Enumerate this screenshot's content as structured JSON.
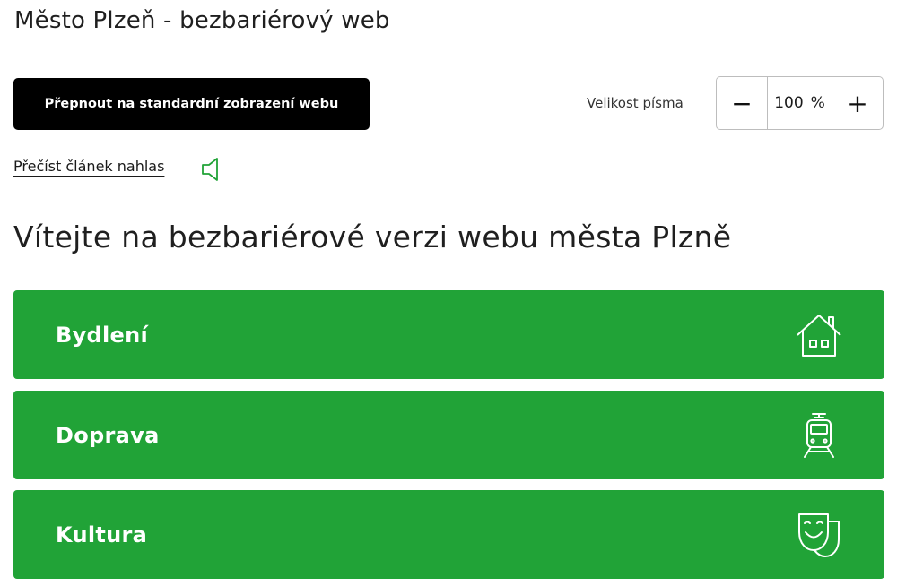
{
  "header": {
    "site_title": "Město Plzeň - bezbariérový web"
  },
  "toolbar": {
    "switch_label": "Přepnout na standardní zobrazení webu",
    "font_size_label": "Velikost písma",
    "font_size_value": "100",
    "font_size_unit": "%",
    "minus_label": "−",
    "plus_label": "+"
  },
  "read_aloud": {
    "label": "Přečíst článek nahlas",
    "icon": "speaker-icon"
  },
  "main": {
    "heading": "Vítejte na bezbariérové verzi webu města Plzně",
    "tiles": [
      {
        "label": "Bydlení",
        "icon": "house-icon"
      },
      {
        "label": "Doprava",
        "icon": "tram-icon"
      },
      {
        "label": "Kultura",
        "icon": "theatre-mask-icon"
      }
    ]
  },
  "colors": {
    "tile_background": "#21a337",
    "primary_button": "#000000",
    "speaker_icon": "#21a337"
  }
}
